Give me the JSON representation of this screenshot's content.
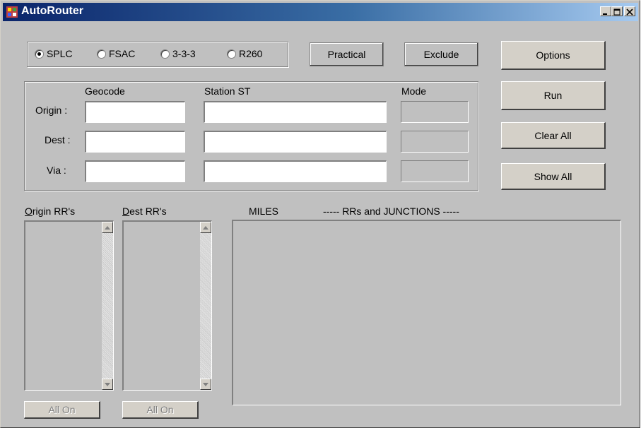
{
  "window": {
    "title": "AutoRouter"
  },
  "format_options": {
    "radios": [
      {
        "label": "SPLC",
        "selected": true
      },
      {
        "label": "FSAC",
        "selected": false
      },
      {
        "label": "3-3-3",
        "selected": false
      },
      {
        "label": "R260",
        "selected": false
      }
    ],
    "practical_label": "Practical",
    "exclude_label": "Exclude"
  },
  "buttons": {
    "options": "Options",
    "run": "Run",
    "clear_all": "Clear All",
    "show_all": "Show All",
    "all_on_origin": "All On",
    "all_on_dest": "All On"
  },
  "form": {
    "col_geocode": "Geocode",
    "col_station": "Station ST",
    "col_mode": "Mode",
    "rows": [
      {
        "label": "Origin :",
        "geocode": "",
        "station": "",
        "mode": ""
      },
      {
        "label": "Dest :",
        "geocode": "",
        "station": "",
        "mode": ""
      },
      {
        "label": "Via :",
        "geocode": "",
        "station": "",
        "mode": ""
      }
    ]
  },
  "lists": {
    "origin_rrs_first": "O",
    "origin_rrs_rest": "rigin RR's",
    "dest_rrs_first": "D",
    "dest_rrs_rest": "est RR's",
    "miles_label": "MILES",
    "rrs_junctions_label": "----- RRs and JUNCTIONS -----"
  }
}
